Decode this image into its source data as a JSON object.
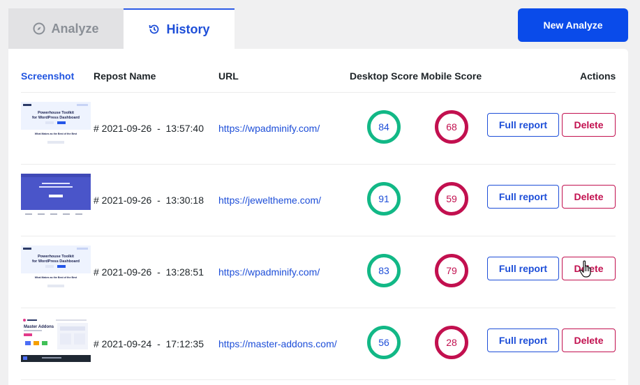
{
  "tabs": {
    "analyze": {
      "label": "Analyze",
      "icon": "compass-icon"
    },
    "history": {
      "label": "History",
      "icon": "history-icon"
    }
  },
  "actions": {
    "new_analyze": "New Analyze"
  },
  "table": {
    "headers": {
      "screenshot": "Screenshot",
      "name": "Repost Name",
      "url": "URL",
      "desktop": "Desktop Score",
      "mobile": "Mobile Score",
      "actions": "Actions"
    },
    "rows": [
      {
        "name": "# 2021-09-26  -  13:57:40",
        "url": "https://wpadminify.com/",
        "desktop": "84",
        "mobile": "68",
        "full_report": "Full report",
        "delete": "Delete",
        "thumb": {
          "title": "Powerhouse Toolkit",
          "subtitle": "for WordPress Dashboard",
          "tagline": "What Makes as the Best of the Best"
        }
      },
      {
        "name": "# 2021-09-26  -  13:30:18",
        "url": "https://jeweltheme.com/",
        "desktop": "91",
        "mobile": "59",
        "full_report": "Full report",
        "delete": "Delete"
      },
      {
        "name": "# 2021-09-26  -  13:28:51",
        "url": "https://wpadminify.com/",
        "desktop": "83",
        "mobile": "79",
        "full_report": "Full report",
        "delete": "Delete",
        "thumb": {
          "title": "Powerhouse Toolkit",
          "subtitle": "for WordPress Dashboard",
          "tagline": "What Makes as the Best of the Best"
        }
      },
      {
        "name": "# 2021-09-24  -  17:12:35",
        "url": "https://master-addons.com/",
        "desktop": "56",
        "mobile": "28",
        "full_report": "Full report",
        "delete": "Delete",
        "thumb": {
          "title": "Master Addons"
        }
      }
    ]
  },
  "colors": {
    "accent": "#0a4bea",
    "desktop_ring": "#12b886",
    "mobile_ring": "#c2104f",
    "delete": "#c2104f"
  }
}
